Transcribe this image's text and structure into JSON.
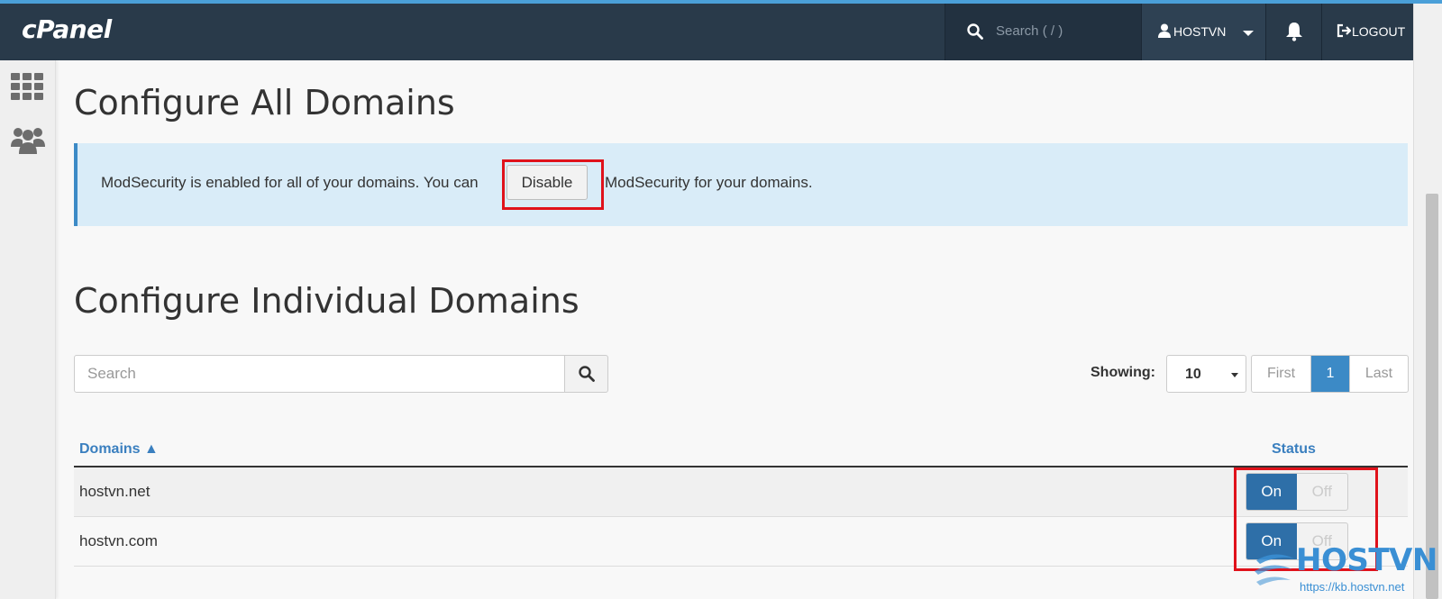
{
  "app": {
    "logo": "cPanel"
  },
  "topbar": {
    "search_placeholder": "Search ( / )",
    "username": "HOSTVN",
    "logout_label": "LOGOUT"
  },
  "all_domains": {
    "heading": "Configure All Domains",
    "alert_text_before": "ModSecurity is enabled for all of your domains. You can",
    "alert_text_after": "ModSecurity for your domains.",
    "disable_label": "Disable"
  },
  "individual": {
    "heading": "Configure Individual Domains",
    "search_placeholder": "Search",
    "showing_label": "Showing:",
    "per_page_value": "10",
    "pagination": {
      "first": "First",
      "current": "1",
      "last": "Last"
    },
    "columns": {
      "domains": "Domains ▲",
      "status": "Status"
    },
    "rows": [
      {
        "domain": "hostvn.net",
        "on_label": "On",
        "off_label": "Off",
        "state": "on"
      },
      {
        "domain": "hostvn.com",
        "on_label": "On",
        "off_label": "Off",
        "state": "on"
      }
    ]
  },
  "watermark": {
    "brand": "HOSTVN",
    "url": "https://kb.hostvn.net"
  },
  "colors": {
    "topbar": "#293a4a",
    "accent": "#3c8ac6",
    "alert_bg": "#d9ecf8",
    "highlight": "#e0121b"
  }
}
